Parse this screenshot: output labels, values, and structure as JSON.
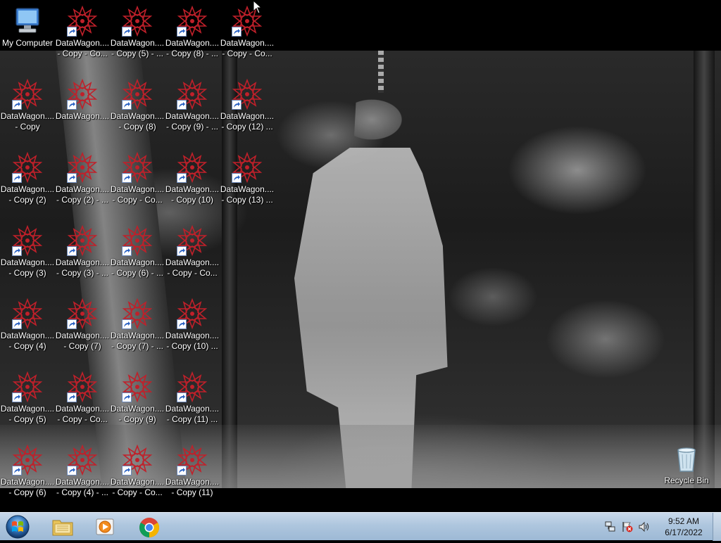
{
  "desktop": {
    "icons": [
      {
        "name": "desktop-icon-my-computer",
        "line1": "My Computer",
        "line2": "",
        "type": "computer"
      },
      {
        "name": "desktop-icon-datawagon",
        "line1": "DataWagon....",
        "line2": "- Copy - Co...",
        "type": "shortcut"
      },
      {
        "name": "desktop-icon-datawagon",
        "line1": "DataWagon....",
        "line2": "- Copy (5) - ...",
        "type": "shortcut"
      },
      {
        "name": "desktop-icon-datawagon",
        "line1": "DataWagon....",
        "line2": "- Copy (8) - ...",
        "type": "shortcut"
      },
      {
        "name": "desktop-icon-datawagon",
        "line1": "DataWagon....",
        "line2": "- Copy - Co...",
        "type": "shortcut"
      },
      {
        "name": "desktop-icon-datawagon",
        "line1": "DataWagon....",
        "line2": "- Copy",
        "type": "shortcut"
      },
      {
        "name": "desktop-icon-datawagon",
        "line1": "DataWagon....",
        "line2": "",
        "type": "shortcut"
      },
      {
        "name": "desktop-icon-datawagon",
        "line1": "DataWagon....",
        "line2": "- Copy (8)",
        "type": "shortcut"
      },
      {
        "name": "desktop-icon-datawagon",
        "line1": "DataWagon....",
        "line2": "- Copy (9) - ...",
        "type": "shortcut"
      },
      {
        "name": "desktop-icon-datawagon",
        "line1": "DataWagon....",
        "line2": "- Copy (12) ...",
        "type": "shortcut"
      },
      {
        "name": "desktop-icon-datawagon",
        "line1": "DataWagon....",
        "line2": "- Copy (2)",
        "type": "shortcut"
      },
      {
        "name": "desktop-icon-datawagon",
        "line1": "DataWagon....",
        "line2": "- Copy (2) - ...",
        "type": "shortcut"
      },
      {
        "name": "desktop-icon-datawagon",
        "line1": "DataWagon....",
        "line2": "- Copy - Co...",
        "type": "shortcut"
      },
      {
        "name": "desktop-icon-datawagon",
        "line1": "DataWagon....",
        "line2": "- Copy (10)",
        "type": "shortcut"
      },
      {
        "name": "desktop-icon-datawagon",
        "line1": "DataWagon....",
        "line2": "- Copy (13) ...",
        "type": "shortcut"
      },
      {
        "name": "desktop-icon-datawagon",
        "line1": "DataWagon....",
        "line2": "- Copy (3)",
        "type": "shortcut"
      },
      {
        "name": "desktop-icon-datawagon",
        "line1": "DataWagon....",
        "line2": "- Copy (3) - ...",
        "type": "shortcut"
      },
      {
        "name": "desktop-icon-datawagon",
        "line1": "DataWagon....",
        "line2": "- Copy (6) - ...",
        "type": "shortcut"
      },
      {
        "name": "desktop-icon-datawagon",
        "line1": "DataWagon....",
        "line2": "- Copy - Co...",
        "type": "shortcut"
      },
      {
        "name": "desktop-icon-datawagon",
        "line1": "DataWagon....",
        "line2": "- Copy (4)",
        "type": "shortcut"
      },
      {
        "name": "desktop-icon-datawagon",
        "line1": "DataWagon....",
        "line2": "- Copy (7)",
        "type": "shortcut"
      },
      {
        "name": "desktop-icon-datawagon",
        "line1": "DataWagon....",
        "line2": "- Copy (7) - ...",
        "type": "shortcut"
      },
      {
        "name": "desktop-icon-datawagon",
        "line1": "DataWagon....",
        "line2": "- Copy (10) ...",
        "type": "shortcut"
      },
      {
        "name": "desktop-icon-datawagon",
        "line1": "DataWagon....",
        "line2": "- Copy (5)",
        "type": "shortcut"
      },
      {
        "name": "desktop-icon-datawagon",
        "line1": "DataWagon....",
        "line2": "- Copy - Co...",
        "type": "shortcut"
      },
      {
        "name": "desktop-icon-datawagon",
        "line1": "DataWagon....",
        "line2": "- Copy (9)",
        "type": "shortcut"
      },
      {
        "name": "desktop-icon-datawagon",
        "line1": "DataWagon....",
        "line2": "- Copy (11) ...",
        "type": "shortcut"
      },
      {
        "name": "desktop-icon-datawagon",
        "line1": "DataWagon....",
        "line2": "- Copy (6)",
        "type": "shortcut"
      },
      {
        "name": "desktop-icon-datawagon",
        "line1": "DataWagon....",
        "line2": "- Copy (4) - ...",
        "type": "shortcut"
      },
      {
        "name": "desktop-icon-datawagon",
        "line1": "DataWagon....",
        "line2": "- Copy - Co...",
        "type": "shortcut"
      },
      {
        "name": "desktop-icon-datawagon",
        "line1": "DataWagon....",
        "line2": "- Copy (11)",
        "type": "shortcut"
      }
    ],
    "recycle_bin": {
      "line1": "Recycle Bin",
      "line2": ""
    }
  },
  "taskbar": {
    "start_icon": "windows-start-orb-icon",
    "pinned": [
      {
        "name": "taskbar-file-explorer-button",
        "icon": "folder-icon"
      },
      {
        "name": "taskbar-media-player-button",
        "icon": "media-player-icon"
      },
      {
        "name": "taskbar-chrome-button",
        "icon": "chrome-icon"
      }
    ],
    "tray": {
      "icons": [
        "network-icon",
        "action-center-flag-icon",
        "volume-icon"
      ],
      "time": "9:52 AM",
      "date": "6/17/2022"
    }
  },
  "colors": {
    "taskbar_top": "#c9d9ea",
    "taskbar_bottom": "#9db9d5",
    "icon_red": "#c0202a",
    "label_text": "#ffffff"
  }
}
